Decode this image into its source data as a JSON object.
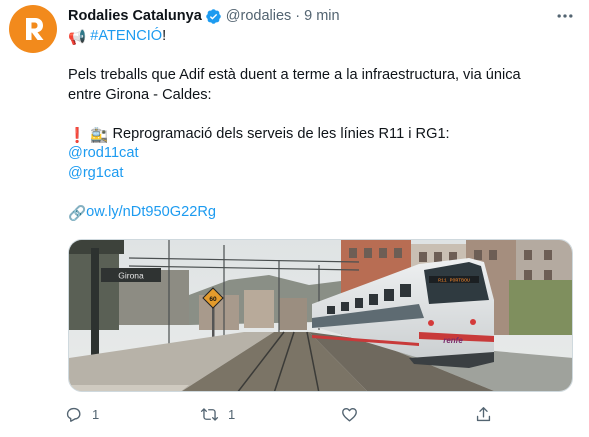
{
  "tweet": {
    "author_name": "Rodalies Catalunya",
    "author_handle": "@rodalies",
    "separator": "·",
    "time": "9 min",
    "avatar": {
      "letter_icon": "r-logo-icon",
      "color": "#f28a1c"
    },
    "lines": {
      "l1_emoji": "📢",
      "l1_hashtag": "#ATENCIÓ",
      "l1_end": "!",
      "l2": "Pels treballs que Adif està duent a terme a la infraestructura, via única",
      "l3": "entre Girona - Caldes:",
      "l4_emoji": "❗ 🚉",
      "l4_text": " Reprogramació dels serveis de les línies R11 i RG1:",
      "l5": "@rod11cat",
      "l6": "@rg1cat",
      "l7_emoji": "🔗",
      "l7_link": "ow.ly/nDt950G22Rg"
    },
    "media": {
      "station_sign": "Girona",
      "speed_sign": "60",
      "train_display": "R11 PORTBOU",
      "train_brand": "renfe"
    },
    "actions": {
      "reply_count": "1",
      "retweet_count": "1",
      "like_count": "",
      "share_count": ""
    },
    "colors": {
      "link": "#1d9bf0",
      "muted": "#536471",
      "verified": "#1d9bf0"
    }
  }
}
